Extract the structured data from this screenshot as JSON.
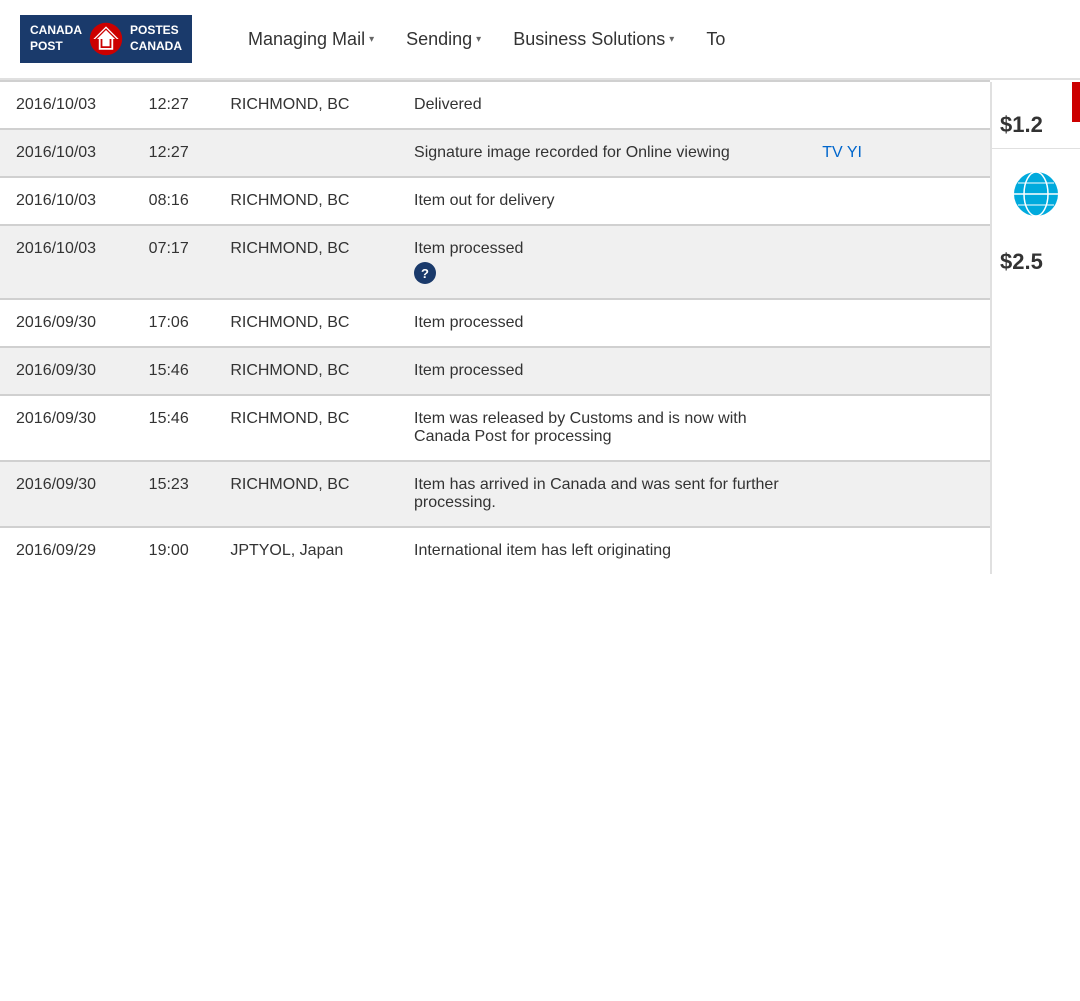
{
  "header": {
    "logo_line1": "CANADA",
    "logo_line2": "POST",
    "logo_line3": "POSTES",
    "logo_line4": "CANADA",
    "nav_items": [
      {
        "label": "Managing Mail",
        "has_arrow": true
      },
      {
        "label": "Sending",
        "has_arrow": true
      },
      {
        "label": "Business Solutions",
        "has_arrow": true
      },
      {
        "label": "To",
        "has_arrow": false
      }
    ]
  },
  "right_sidebar": {
    "price1": "$1.2",
    "price2": "$2.5"
  },
  "table": {
    "rows": [
      {
        "id": 1,
        "style": "white",
        "date": "2016/10/03",
        "time": "12:27",
        "location": "RICHMOND, BC",
        "description": "Delivered",
        "extra": "",
        "has_help": false,
        "has_link": false,
        "link_text": ""
      },
      {
        "id": 2,
        "style": "gray",
        "date": "2016/10/03",
        "time": "12:27",
        "location": "",
        "description": "Signature image recorded for Online viewing",
        "extra": "",
        "has_help": false,
        "has_link": true,
        "link_text": "TV YI"
      },
      {
        "id": 3,
        "style": "white",
        "date": "2016/10/03",
        "time": "08:16",
        "location": "RICHMOND, BC",
        "description": "Item out for delivery",
        "extra": "",
        "has_help": false,
        "has_link": false,
        "link_text": ""
      },
      {
        "id": 4,
        "style": "gray",
        "date": "2016/10/03",
        "time": "07:17",
        "location": "RICHMOND, BC",
        "description": "Item processed",
        "extra": "",
        "has_help": true,
        "has_link": false,
        "link_text": ""
      },
      {
        "id": 5,
        "style": "white",
        "date": "2016/09/30",
        "time": "17:06",
        "location": "RICHMOND, BC",
        "description": "Item processed",
        "extra": "",
        "has_help": false,
        "has_link": false,
        "link_text": ""
      },
      {
        "id": 6,
        "style": "gray",
        "date": "2016/09/30",
        "time": "15:46",
        "location": "RICHMOND, BC",
        "description": "Item processed",
        "extra": "",
        "has_help": false,
        "has_link": false,
        "link_text": ""
      },
      {
        "id": 7,
        "style": "white",
        "date": "2016/09/30",
        "time": "15:46",
        "location": "RICHMOND, BC",
        "description": "Item was released by Customs and is now with Canada Post for processing",
        "extra": "",
        "has_help": false,
        "has_link": false,
        "link_text": ""
      },
      {
        "id": 8,
        "style": "gray",
        "date": "2016/09/30",
        "time": "15:23",
        "location": "RICHMOND, BC",
        "description": "Item has arrived in Canada and was sent for further processing.",
        "extra": "",
        "has_help": false,
        "has_link": false,
        "link_text": ""
      },
      {
        "id": 9,
        "style": "white",
        "date": "2016/09/29",
        "time": "19:00",
        "location": "JPTYOL, Japan",
        "description": "International item has left originating",
        "extra": "",
        "has_help": false,
        "has_link": false,
        "link_text": ""
      }
    ],
    "help_label": "?"
  }
}
